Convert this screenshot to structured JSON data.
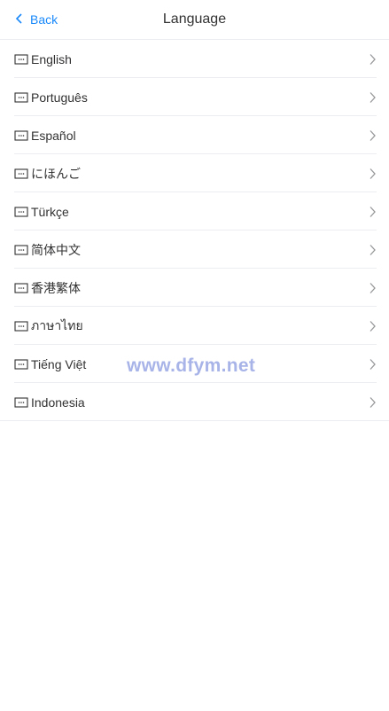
{
  "nav": {
    "back_label": "Back",
    "title": "Language"
  },
  "languages": [
    {
      "label": "English"
    },
    {
      "label": "Português"
    },
    {
      "label": "Español"
    },
    {
      "label": "にほんご"
    },
    {
      "label": "Türkçe"
    },
    {
      "label": "简体中文"
    },
    {
      "label": "香港繁体"
    },
    {
      "label": "ภาษาไทย"
    },
    {
      "label": "Tiếng Việt"
    },
    {
      "label": "Indonesia"
    }
  ],
  "watermark": "www.dfym.net",
  "colors": {
    "accent": "#1989fa",
    "text": "#323233",
    "divider": "#ebedf0",
    "watermark": "#a8b4e8"
  },
  "icons": {
    "back": "chevron-left-icon",
    "row": "message-box-icon",
    "arrow": "chevron-right-icon"
  }
}
